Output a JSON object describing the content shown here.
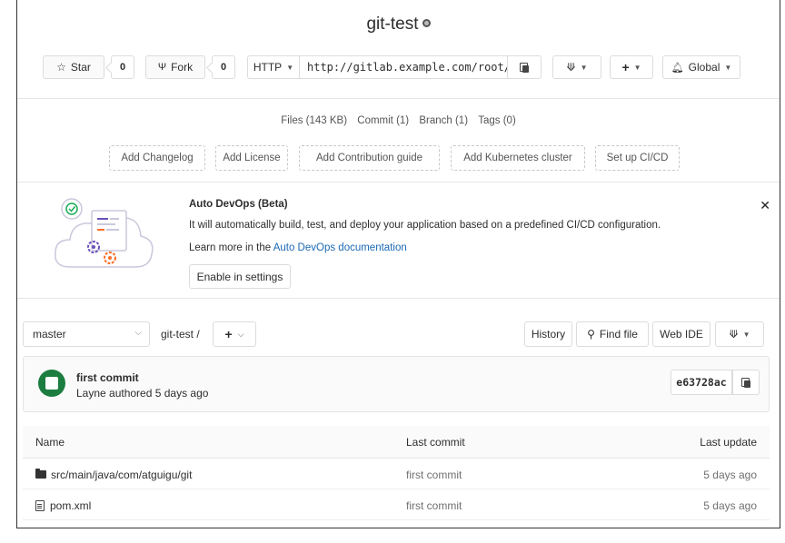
{
  "project": {
    "name": "git-test"
  },
  "actions": {
    "star_label": "Star",
    "star_count": "0",
    "fork_label": "Fork",
    "fork_count": "0",
    "protocol": "HTTP",
    "clone_url": "http://gitlab.example.com/root/git-test.git",
    "notify_label": "Global"
  },
  "stats": {
    "files": "Files (143 KB)",
    "commit": "Commit (1)",
    "branch": "Branch (1)",
    "tags": "Tags (0)"
  },
  "quick_actions": [
    "Add Changelog",
    "Add License",
    "Add Contribution guide",
    "Add Kubernetes cluster",
    "Set up CI/CD"
  ],
  "autodevops": {
    "title": "Auto DevOps (Beta)",
    "description": "It will automatically build, test, and deploy your application based on a predefined CI/CD configuration.",
    "learn_prefix": "Learn more in the ",
    "learn_link": "Auto DevOps documentation",
    "enable_button": "Enable in settings"
  },
  "tree": {
    "branch": "master",
    "breadcrumb": "git-test /",
    "history_button": "History",
    "find_file_button": "Find file",
    "web_ide_button": "Web IDE"
  },
  "last_commit": {
    "title": "first commit",
    "author_line": "Layne authored 5 days ago",
    "sha": "e63728ac"
  },
  "table": {
    "headers": {
      "name": "Name",
      "last_commit": "Last commit",
      "last_update": "Last update"
    },
    "rows": [
      {
        "name": "src/main/java/com/atguigu/git",
        "type": "folder",
        "commit": "first commit",
        "updated": "5 days ago"
      },
      {
        "name": "pom.xml",
        "type": "file",
        "commit": "first commit",
        "updated": "5 days ago"
      }
    ]
  },
  "colors": {
    "link": "#1b69b6",
    "avatar": "#1b7d3f",
    "accent_green": "#1aaa55",
    "accent_orange": "#fc6d26"
  }
}
